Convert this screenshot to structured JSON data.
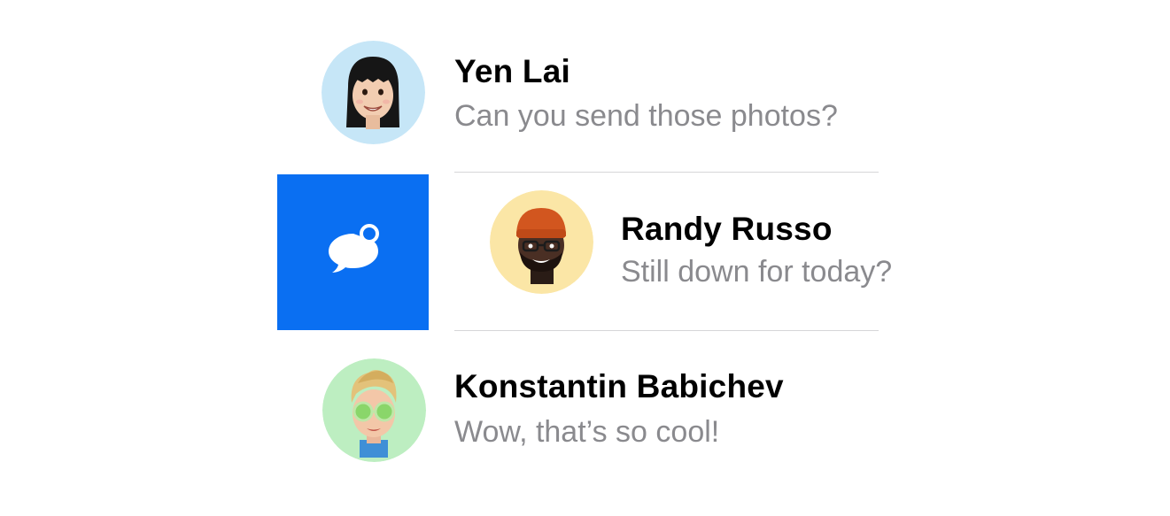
{
  "colors": {
    "action_blue": "#0a6ff2",
    "name_text": "#000000",
    "preview_text": "#8a8a8e",
    "separator": "#d6d6d8"
  },
  "swipe_action": {
    "icon": "unread-message-icon",
    "color": "#0a6ff2"
  },
  "conversations": [
    {
      "name": "Yen Lai",
      "preview": "Can you send those photos?",
      "avatar_icon": "memoji-avatar",
      "avatar_bg": "#c6e6f7"
    },
    {
      "name": "Randy Russo",
      "preview": "Still down for today?",
      "avatar_icon": "memoji-avatar",
      "avatar_bg": "#fbe6a6"
    },
    {
      "name": "Konstantin Babichev",
      "preview": "Wow, that’s so cool!",
      "avatar_icon": "memoji-avatar",
      "avatar_bg": "#bdeec1"
    }
  ]
}
